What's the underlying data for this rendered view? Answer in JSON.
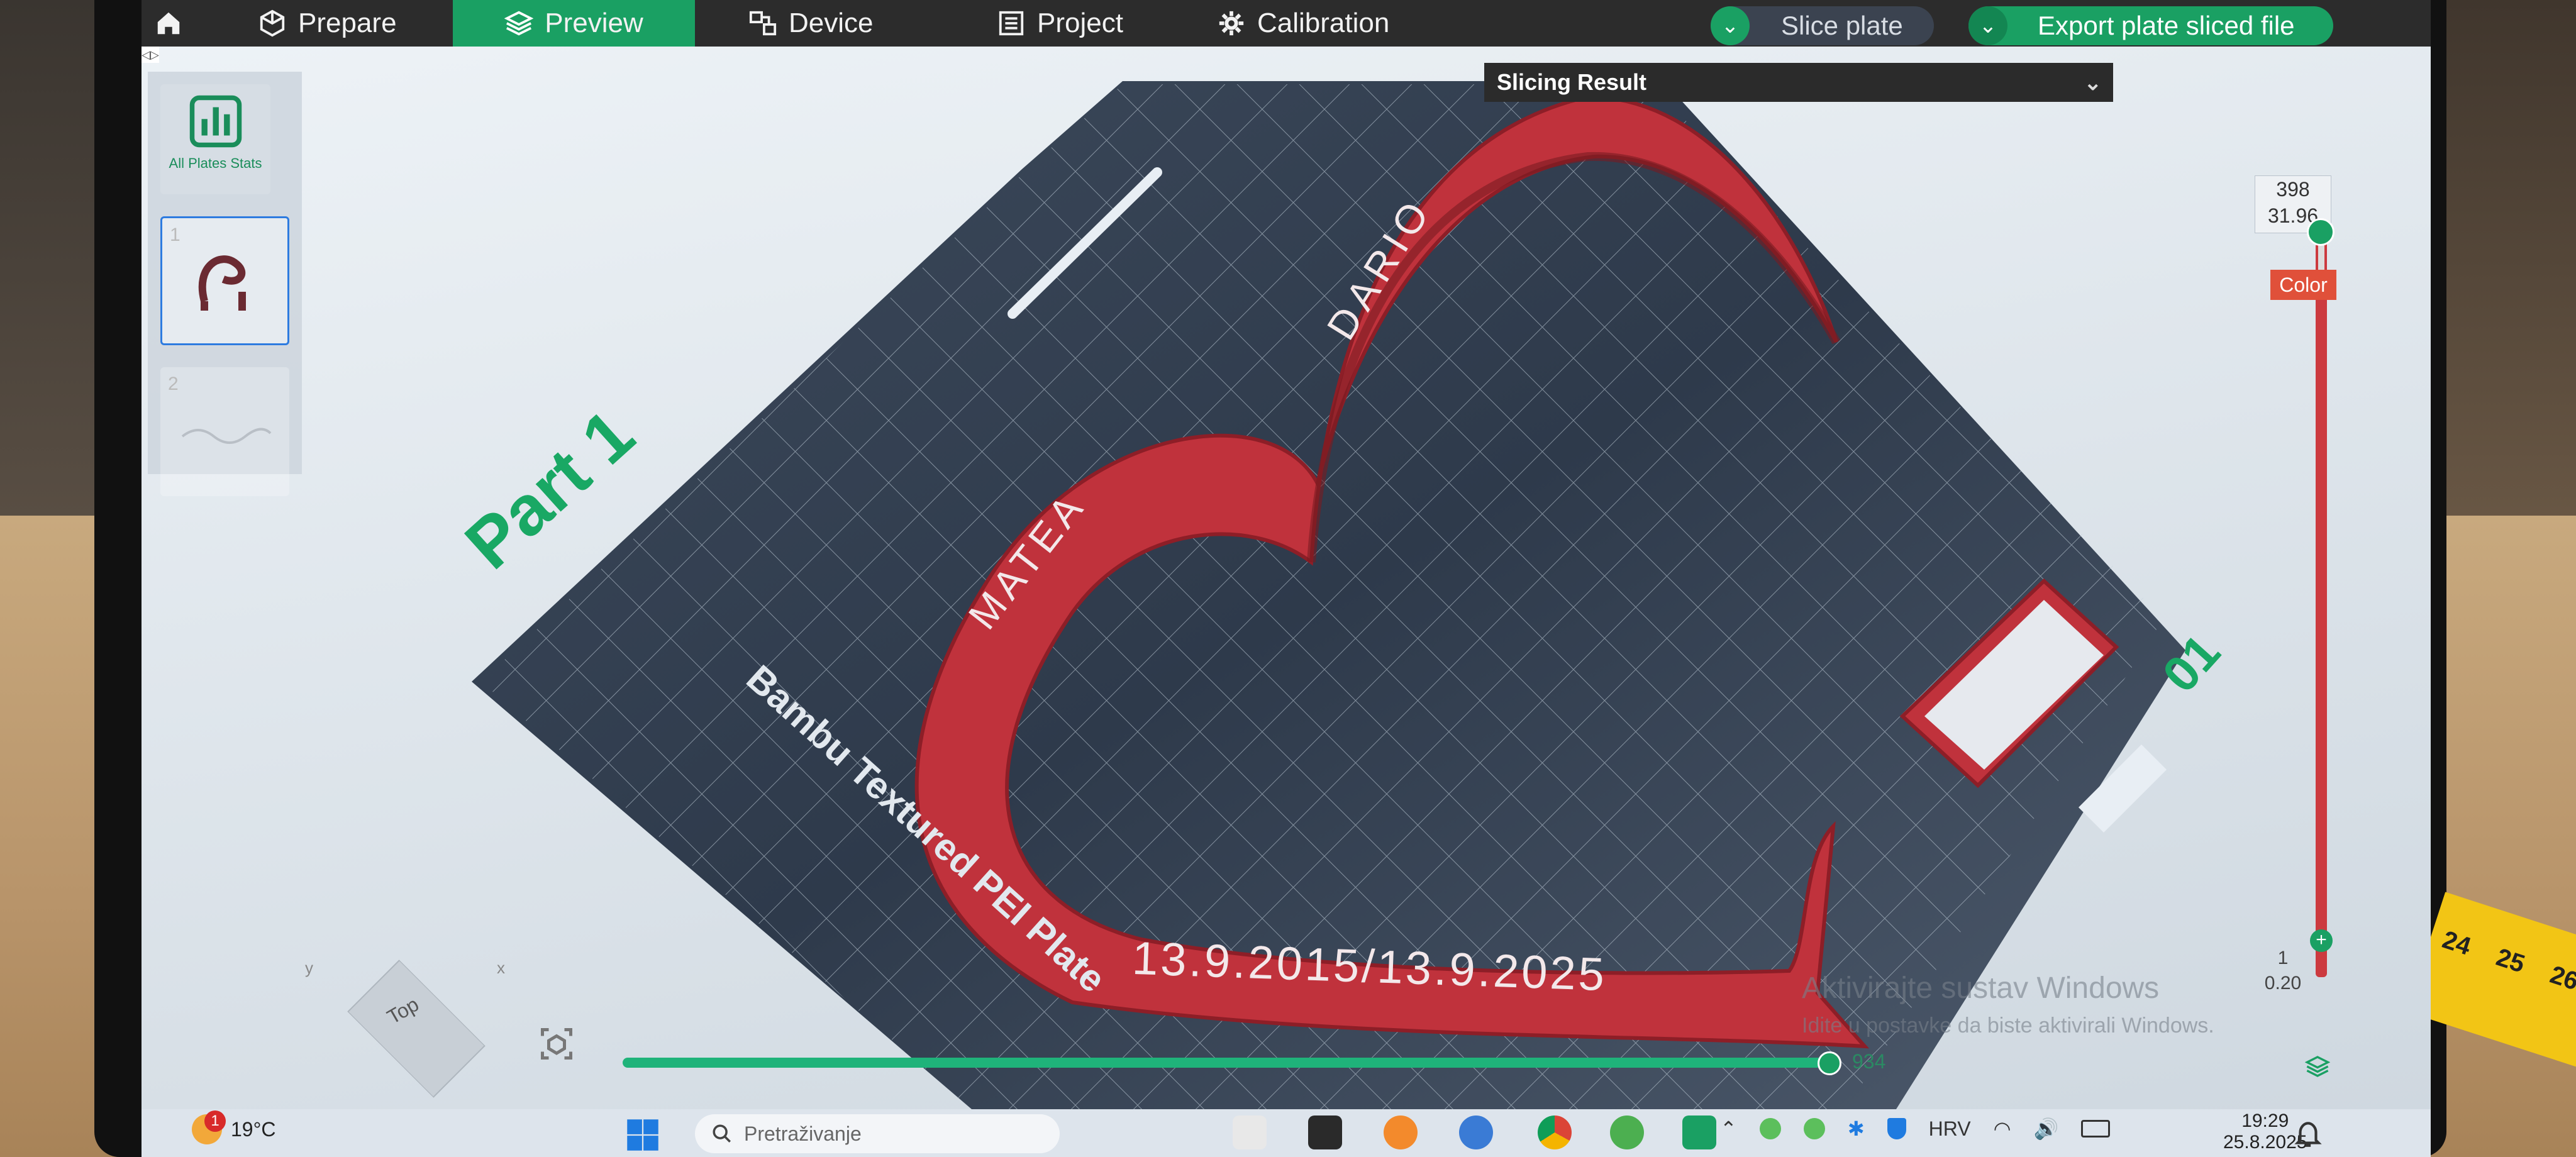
{
  "toolbar": {
    "home_icon": "home-icon",
    "tabs": [
      {
        "label": "Prepare",
        "icon": "cube-icon"
      },
      {
        "label": "Preview",
        "icon": "layers-icon",
        "active": true
      },
      {
        "label": "Device",
        "icon": "device-icon"
      },
      {
        "label": "Project",
        "icon": "project-icon"
      },
      {
        "label": "Calibration",
        "icon": "gear-icon"
      }
    ],
    "slice_plate": "Slice plate",
    "export_plate": "Export plate sliced file",
    "accent_color": "#1aa063"
  },
  "slicing_result": {
    "label": "Slicing Result"
  },
  "plates_panel": {
    "toggle": "◁▷",
    "all_plates_stats": "All Plates Stats",
    "plates": [
      {
        "number": "1",
        "selected": true
      },
      {
        "number": "2",
        "selected": false
      }
    ]
  },
  "scene": {
    "part_label": "Part 1",
    "plate_number": "01",
    "plate_text": "Bambu Textured PEI Plate",
    "model_text_left": "MATEA",
    "model_text_top": "DARIO",
    "model_text_bottom": "13.9.2015/13.9.2025",
    "model_color": "#c0323c"
  },
  "layer_slider": {
    "top_layer": "398",
    "top_height": "31.96",
    "bottom_layer": "1",
    "bottom_height": "0.20",
    "color_label": "Color",
    "color_badge_color": "#e0503a"
  },
  "move_slider": {
    "value": "934"
  },
  "view_cube": {
    "label": "Top",
    "axis_x": "x",
    "axis_y": "y"
  },
  "watermark": {
    "title": "Aktivirajte sustav Windows",
    "subtitle": "Idite u postavke da biste aktivirali Windows."
  },
  "taskbar": {
    "weather_temp": "19°C",
    "weather_badge": "1",
    "search_placeholder": "Pretraživanje",
    "language": "HRV",
    "time": "19:29",
    "date": "25.8.2025"
  },
  "tape_numbers": [
    "24",
    "25",
    "26"
  ]
}
